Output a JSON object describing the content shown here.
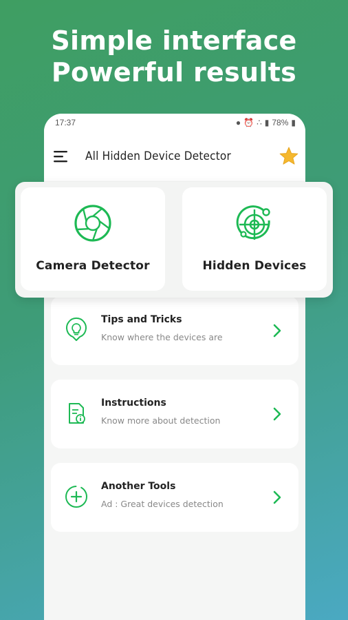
{
  "headline": {
    "line1": "Simple interface",
    "line2": "Powerful results"
  },
  "status_bar": {
    "time": "17:37",
    "battery": "78%"
  },
  "app_bar": {
    "title": "All Hidden Device Detector"
  },
  "features": [
    {
      "label": "Camera Detector",
      "icon": "camera-aperture-icon"
    },
    {
      "label": "Hidden Devices",
      "icon": "radar-target-icon"
    }
  ],
  "list": [
    {
      "title": "Tips and Tricks",
      "subtitle": "Know where the devices are",
      "icon": "lightbulb-pin-icon"
    },
    {
      "title": "Instructions",
      "subtitle": "Know more about detection",
      "icon": "document-info-icon"
    },
    {
      "title": "Another Tools",
      "subtitle": "Ad : Great devices detection",
      "icon": "add-circle-icon"
    }
  ],
  "colors": {
    "accent": "#1db954",
    "star": "#f5b82e",
    "bg_top": "#3f9e62",
    "bg_bottom": "#4aa9c2"
  }
}
